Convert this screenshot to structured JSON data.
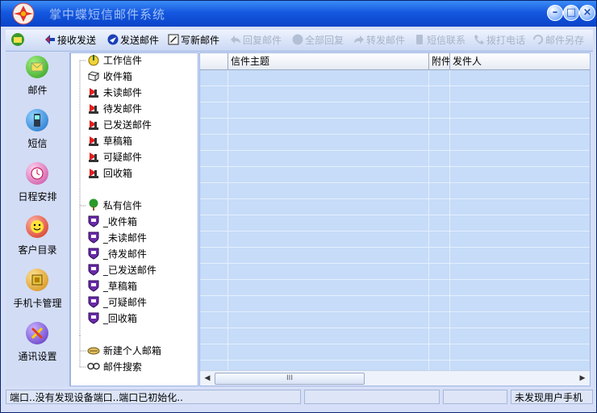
{
  "window": {
    "title": "掌中蝶短信邮件系统",
    "controls": [
      "minimize",
      "restore",
      "close"
    ]
  },
  "toolbar": {
    "items": [
      {
        "label": "",
        "icon": "mail-home-icon",
        "enabled": true
      },
      {
        "label": "接收发送",
        "icon": "send-receive-icon",
        "enabled": true
      },
      {
        "label": "发送邮件",
        "icon": "send-mail-icon",
        "enabled": true
      },
      {
        "label": "写新邮件",
        "icon": "compose-icon",
        "enabled": true
      },
      {
        "label": "回复邮件",
        "icon": "reply-icon",
        "enabled": false
      },
      {
        "label": "全部回复",
        "icon": "reply-all-icon",
        "enabled": false
      },
      {
        "label": "转发邮件",
        "icon": "forward-icon",
        "enabled": false
      },
      {
        "label": "短信联系",
        "icon": "sms-contact-icon",
        "enabled": false
      },
      {
        "label": "拨打电话",
        "icon": "phone-call-icon",
        "enabled": false
      },
      {
        "label": "邮件另存",
        "icon": "save-as-icon",
        "enabled": false
      }
    ]
  },
  "sidebar": {
    "items": [
      {
        "label": "邮件",
        "icon": "mail-icon"
      },
      {
        "label": "短信",
        "icon": "mobile-phone-icon"
      },
      {
        "label": "日程安排",
        "icon": "calendar-icon"
      },
      {
        "label": "客户目录",
        "icon": "smiley-contacts-icon"
      },
      {
        "label": "手机卡管理",
        "icon": "sim-card-icon"
      },
      {
        "label": "通讯设置",
        "icon": "tools-settings-icon"
      }
    ]
  },
  "tree": {
    "work": {
      "label": "工作信件",
      "icon": "work-folder-icon"
    },
    "work_items": [
      "收件箱",
      "未读邮件",
      "待发邮件",
      "已发送邮件",
      "草稿箱",
      "可疑邮件",
      "回收箱"
    ],
    "private": {
      "label": "私有信件",
      "icon": "tree-icon"
    },
    "private_items": [
      "_收件箱",
      "_未读邮件",
      "_待发邮件",
      "_已发送邮件",
      "_草稿箱",
      "_可疑邮件",
      "_回收箱"
    ],
    "new_mailbox": "新建个人邮箱",
    "search": "邮件搜索"
  },
  "mail_list": {
    "columns": [
      "",
      "信件主题",
      "附件",
      "发件人"
    ],
    "scroll_thumb_label": "III"
  },
  "status": {
    "message": "端口..没有发现设备端口..端口已初始化..",
    "user_status": "未发现用户手机"
  },
  "colors": {
    "title_bar": "#1558e0",
    "list_background": "#c6dcf8",
    "sidebar_background": "#d2dcf5"
  }
}
